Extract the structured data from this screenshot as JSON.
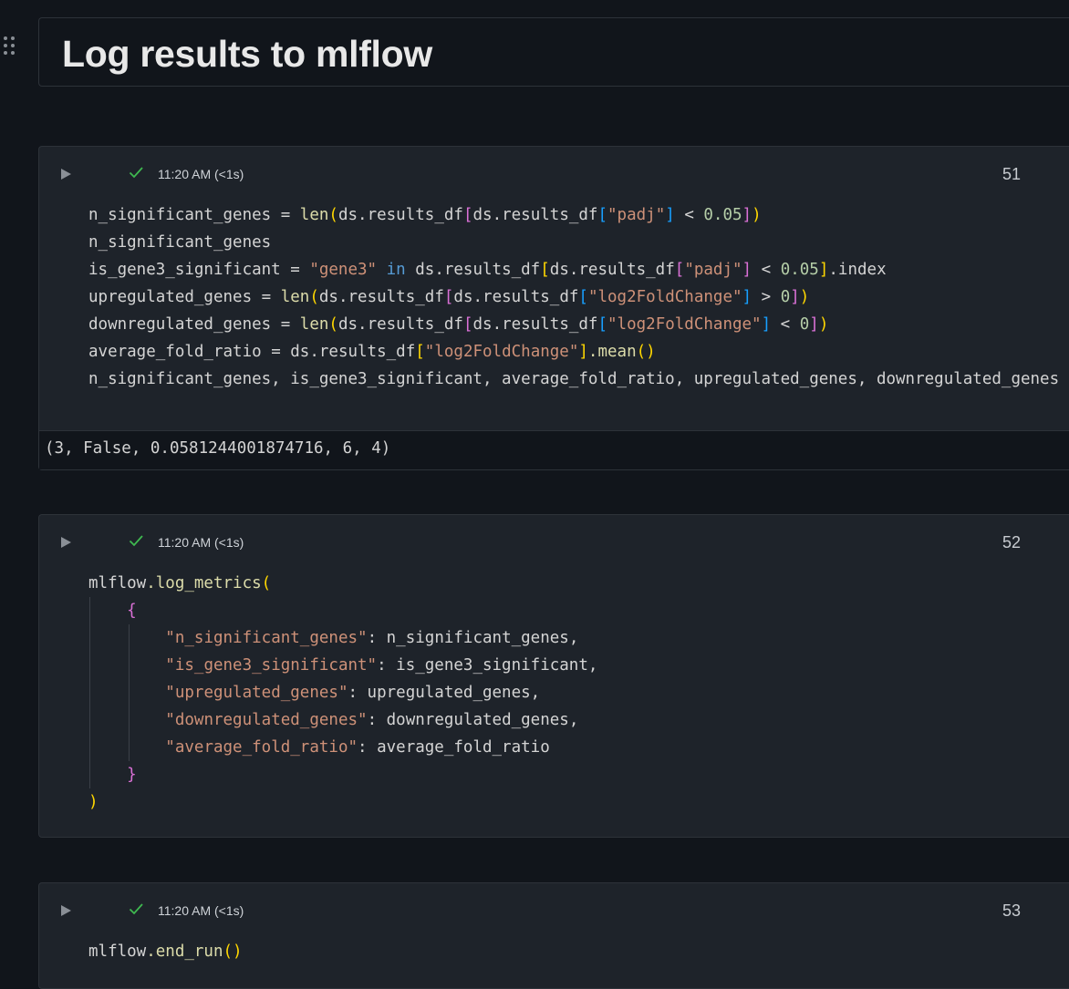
{
  "title": "Log results to mlflow",
  "colors": {
    "background": "#11151b",
    "cell_background": "#1e232a",
    "check": "#3fb950",
    "string": "#ce9178",
    "function": "#dcdcaa",
    "number": "#b5cea8",
    "keyword": "#569cd6"
  },
  "cells": [
    {
      "status_time": "11:20 AM (<1s)",
      "exec_count": "51",
      "output": "(3, False, 0.0581244001874716, 6, 4)"
    },
    {
      "status_time": "11:20 AM (<1s)",
      "exec_count": "52"
    },
    {
      "status_time": "11:20 AM (<1s)",
      "exec_count": "53"
    }
  ],
  "code": {
    "c1": {
      "v_nsig": "n_significant_genes",
      "eq": " = ",
      "f_len": "len",
      "p_open": "(",
      "p_close": ")",
      "v_ds": "ds",
      "dot_results": ".results_df",
      "b_open": "[",
      "b_close": "]",
      "s_padj": "\"padj\"",
      "lt": " < ",
      "gt": " > ",
      "n_005": "0.05",
      "n_0": "0",
      "v_isg3": "is_gene3_significant",
      "s_gene3": "\"gene3\"",
      "kw_in": " in ",
      "dot_index": ".index",
      "v_up": "upregulated_genes",
      "s_l2fc": "\"log2FoldChange\"",
      "v_down": "downregulated_genes",
      "v_avg": "average_fold_ratio",
      "f_mean": ".mean",
      "empty_parens": "()",
      "last_line": "n_significant_genes, is_gene3_significant, average_fold_ratio, upregulated_genes, downregulated_genes"
    },
    "c2": {
      "v_mlflow": "mlflow",
      "f_log_metrics": ".log_metrics",
      "p_open": "(",
      "p_close": ")",
      "brace_open": "{",
      "brace_close": "}",
      "k1": "\"n_significant_genes\"",
      "v1": ": n_significant_genes,",
      "k2": "\"is_gene3_significant\"",
      "v2": ": is_gene3_significant,",
      "k3": "\"upregulated_genes\"",
      "v3": ": upregulated_genes,",
      "k4": "\"downregulated_genes\"",
      "v4": ": downregulated_genes,",
      "k5": "\"average_fold_ratio\"",
      "v5": ": average_fold_ratio"
    },
    "c3": {
      "v_mlflow": "mlflow",
      "f_end_run": ".end_run",
      "empty_parens": "()"
    }
  }
}
